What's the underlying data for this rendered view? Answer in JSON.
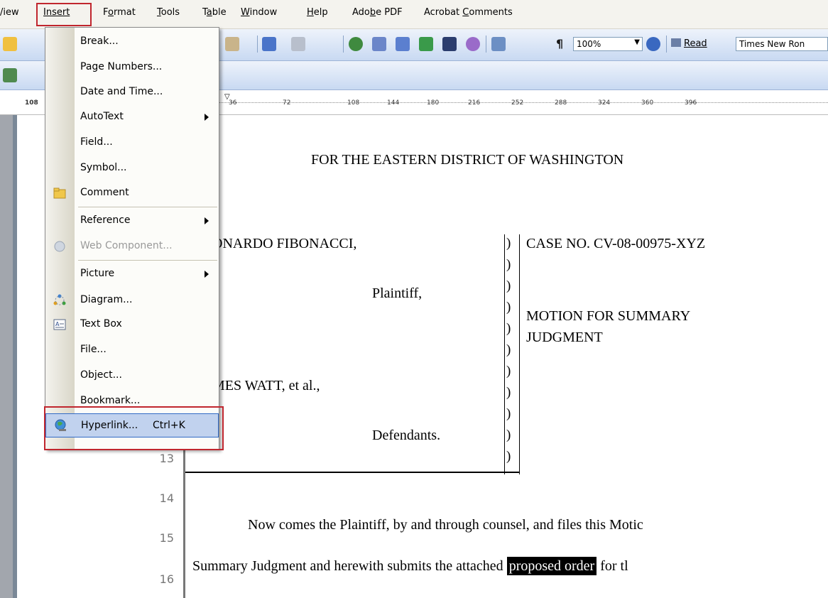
{
  "menubar": {
    "items": [
      {
        "label": "View",
        "u": 0
      },
      {
        "label": "Insert",
        "u": 0
      },
      {
        "label": "Format",
        "u": 1
      },
      {
        "label": "Tools",
        "u": 0
      },
      {
        "label": "Table",
        "u": 1
      },
      {
        "label": "Window",
        "u": 0
      },
      {
        "label": "Help",
        "u": 0
      },
      {
        "label": "Adobe PDF",
        "u": 3
      },
      {
        "label": "Acrobat Comments",
        "u": 8
      }
    ],
    "partial_view": "/iew"
  },
  "toolbar": {
    "zoom": "100%",
    "read_label": "Read",
    "font_name": "Times New Ron",
    "pilcrow": "¶"
  },
  "ruler": {
    "left_value": "108",
    "marks": [
      "36",
      "72",
      "108",
      "144",
      "180",
      "216",
      "252",
      "288",
      "324",
      "360",
      "396"
    ]
  },
  "insert_menu": {
    "items": [
      {
        "label": "Break...",
        "icon": "",
        "submenu": false,
        "disabled": false
      },
      {
        "label": "Page Numbers...",
        "icon": "",
        "submenu": false,
        "disabled": false
      },
      {
        "label": "Date and Time...",
        "icon": "",
        "submenu": false,
        "disabled": false
      },
      {
        "label": "AutoText",
        "icon": "",
        "submenu": true,
        "disabled": false
      },
      {
        "label": "Field...",
        "icon": "",
        "submenu": false,
        "disabled": false
      },
      {
        "label": "Symbol...",
        "icon": "",
        "submenu": false,
        "disabled": false
      },
      {
        "label": "Comment",
        "icon": "comment-folder-icon",
        "submenu": false,
        "disabled": false
      },
      {
        "label": "Reference",
        "icon": "",
        "submenu": true,
        "disabled": false
      },
      {
        "label": "Web Component...",
        "icon": "web-component-icon",
        "submenu": false,
        "disabled": true
      },
      {
        "label": "Picture",
        "icon": "",
        "submenu": true,
        "disabled": false
      },
      {
        "label": "Diagram...",
        "icon": "diagram-icon",
        "submenu": false,
        "disabled": false
      },
      {
        "label": "Text Box",
        "icon": "text-box-icon",
        "submenu": false,
        "disabled": false
      },
      {
        "label": "File...",
        "icon": "",
        "submenu": false,
        "disabled": false
      },
      {
        "label": "Object...",
        "icon": "",
        "submenu": false,
        "disabled": false
      },
      {
        "label": "Bookmark...",
        "icon": "",
        "submenu": false,
        "disabled": false
      },
      {
        "label": "Hyperlink...",
        "icon": "hyperlink-globe-icon",
        "submenu": false,
        "disabled": false,
        "shortcut": "Ctrl+K",
        "highlighted": true
      }
    ]
  },
  "line_numbers": [
    "13",
    "14",
    "15",
    "16"
  ],
  "document": {
    "court_line": "FOR THE EASTERN DISTRICT OF WASHINGTON",
    "plaintiff_name": "ONARDO FIBONACCI,",
    "plaintiff_role": "Plaintiff,",
    "defendant_name": "MES WATT, et al.,",
    "defendant_role": "Defendants.",
    "case_no": "CASE NO. CV-08-00975-XYZ",
    "motion_line1": "MOTION FOR SUMMARY",
    "motion_line2": "JUDGMENT",
    "body_line1": "Now comes the Plaintiff, by and through counsel, and files this Motic",
    "body_line2_pre": "Summary Judgment and herewith submits the attached ",
    "body_line2_hl": "proposed order",
    "body_line2_post": " for tl"
  },
  "colors": {
    "accent_outline": "#c0262e",
    "menu_highlight": "#c1d2ee",
    "toolbar_blue": "#c8d9f2"
  }
}
